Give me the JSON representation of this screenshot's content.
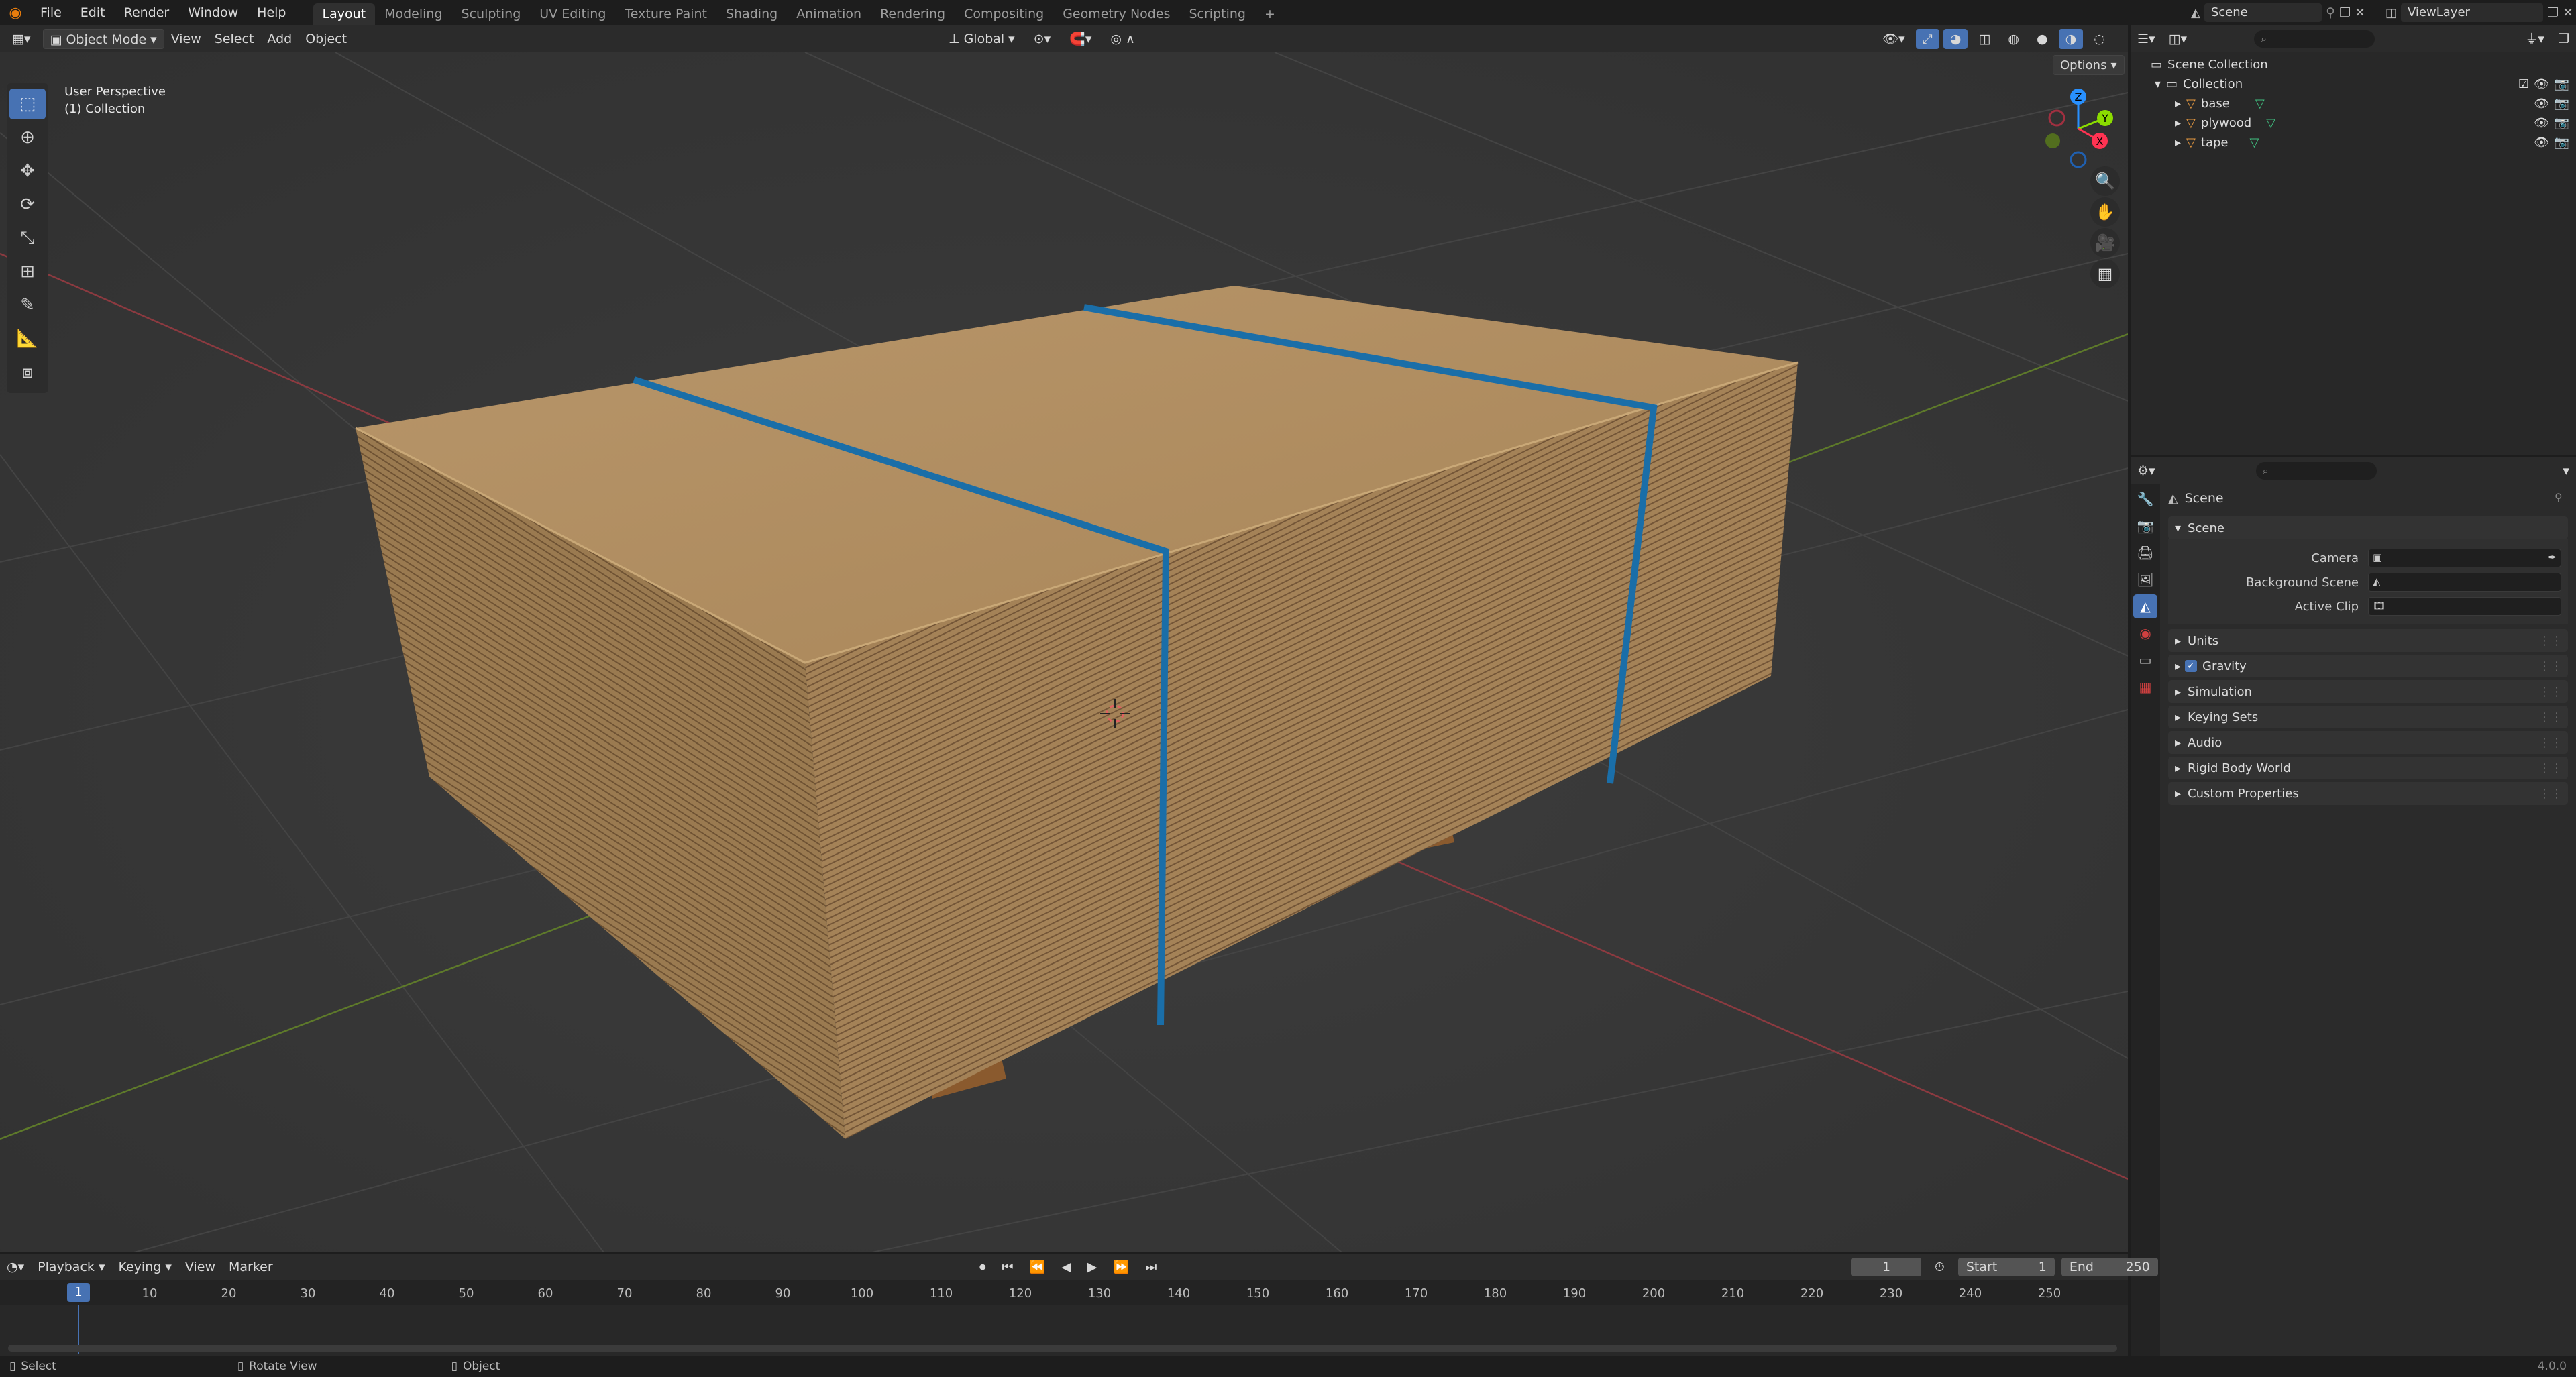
{
  "topbar": {
    "menus": [
      "File",
      "Edit",
      "Render",
      "Window",
      "Help"
    ],
    "workspaces": [
      "Layout",
      "Modeling",
      "Sculpting",
      "UV Editing",
      "Texture Paint",
      "Shading",
      "Animation",
      "Rendering",
      "Compositing",
      "Geometry Nodes",
      "Scripting"
    ],
    "active_workspace": "Layout",
    "add_tab": "+",
    "scene_name": "Scene",
    "view_layer": "ViewLayer"
  },
  "viewport_header": {
    "mode": "Object Mode",
    "menus": [
      "View",
      "Select",
      "Add",
      "Object"
    ],
    "orientation": "Global",
    "options": "Options"
  },
  "viewport": {
    "view_name": "User Perspective",
    "collection_label": "(1) Collection",
    "gizmo": {
      "x": "X",
      "y": "Y",
      "z": "Z"
    }
  },
  "outliner": {
    "root": "Scene Collection",
    "collection": "Collection",
    "objects": [
      "base",
      "plywood",
      "tape"
    ]
  },
  "properties": {
    "context_title": "Scene",
    "scene_panel": "Scene",
    "fields": [
      {
        "label": "Camera"
      },
      {
        "label": "Background Scene"
      },
      {
        "label": "Active Clip"
      }
    ],
    "panels": [
      "Units",
      "Gravity",
      "Simulation",
      "Keying Sets",
      "Audio",
      "Rigid Body World",
      "Custom Properties"
    ]
  },
  "timeline": {
    "menus": [
      "Playback",
      "Keying",
      "View",
      "Marker"
    ],
    "current_frame": "1",
    "start_label": "Start",
    "start_value": "1",
    "end_label": "End",
    "end_value": "250",
    "ticks": [
      "10",
      "20",
      "30",
      "40",
      "50",
      "60",
      "70",
      "80",
      "90",
      "100",
      "110",
      "120",
      "130",
      "140",
      "150",
      "160",
      "170",
      "180",
      "190",
      "200",
      "210",
      "220",
      "230",
      "240",
      "250"
    ],
    "playhead_label": "1"
  },
  "statusbar": {
    "select": "Select",
    "rotate": "Rotate View",
    "object": "Object",
    "version": "4.0.0"
  },
  "colors": {
    "accent": "#4772b3",
    "x_axis": "#ff3352",
    "y_axis": "#8bdc00",
    "z_axis": "#2890ff",
    "tape": "#1a6ea8"
  }
}
